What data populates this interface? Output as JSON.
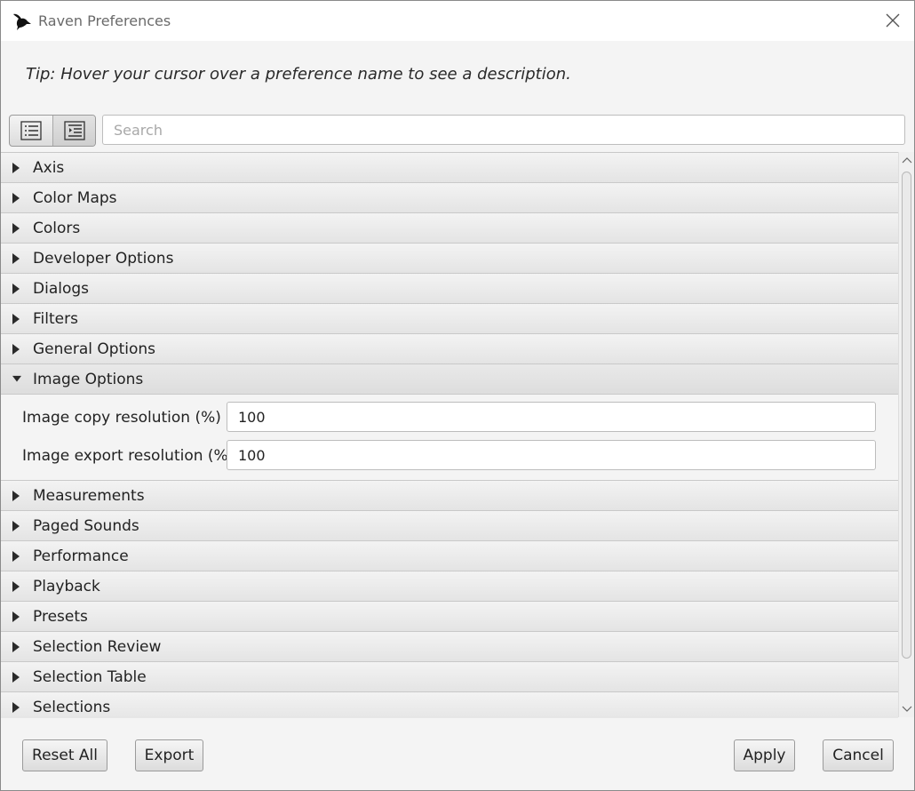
{
  "window": {
    "title": "Raven Preferences",
    "app_icon": "raven-bird-icon",
    "close_icon": "close-icon"
  },
  "tip": "Tip:  Hover your cursor over a preference name to see a description.",
  "toolbar": {
    "view_buttons": [
      "list-view-icon",
      "tree-view-icon"
    ],
    "search_placeholder": "Search"
  },
  "sections_before": [
    {
      "label": "Axis"
    },
    {
      "label": "Color Maps"
    },
    {
      "label": "Colors"
    },
    {
      "label": "Developer Options"
    },
    {
      "label": "Dialogs"
    },
    {
      "label": "Filters"
    },
    {
      "label": "General Options"
    }
  ],
  "expanded_section": {
    "label": "Image Options",
    "prefs": [
      {
        "label": "Image copy resolution (%)",
        "value": "100"
      },
      {
        "label": "Image export resolution (%)",
        "value": "100"
      }
    ]
  },
  "sections_after": [
    {
      "label": "Measurements"
    },
    {
      "label": "Paged Sounds"
    },
    {
      "label": "Performance"
    },
    {
      "label": "Playback"
    },
    {
      "label": "Presets"
    },
    {
      "label": "Selection Review"
    },
    {
      "label": "Selection Table"
    },
    {
      "label": "Selections"
    }
  ],
  "footer": {
    "reset_all": "Reset All",
    "export": "Export",
    "apply": "Apply",
    "cancel": "Cancel"
  }
}
